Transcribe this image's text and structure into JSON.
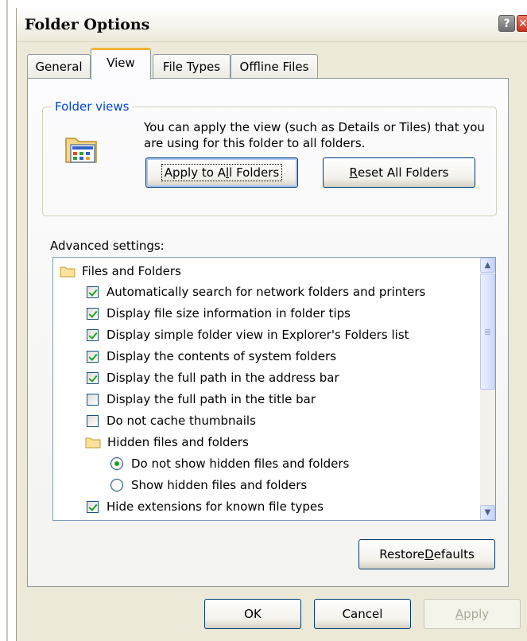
{
  "window": {
    "title": "Folder Options",
    "help_glyph": "?",
    "close_glyph": "✕"
  },
  "tabs": [
    {
      "label": "General",
      "active": false
    },
    {
      "label": "View",
      "active": true
    },
    {
      "label": "File Types",
      "active": false
    },
    {
      "label": "Offline Files",
      "active": false
    }
  ],
  "folder_views": {
    "legend": "Folder views",
    "description": "You can apply the view (such as Details or Tiles) that you are using for this folder to all folders.",
    "apply_button": {
      "pre": "Apply to A",
      "accel": "l",
      "post": "l Folders"
    },
    "reset_button": {
      "pre": "",
      "accel": "R",
      "post": "eset All Folders"
    }
  },
  "advanced": {
    "label": "Advanced settings:",
    "items": [
      {
        "kind": "folder",
        "label": "Files and Folders",
        "indent": 0
      },
      {
        "kind": "checkbox",
        "checked": true,
        "label": "Automatically search for network folders and printers",
        "indent": 1
      },
      {
        "kind": "checkbox",
        "checked": true,
        "label": "Display file size information in folder tips",
        "indent": 1
      },
      {
        "kind": "checkbox",
        "checked": true,
        "label": "Display simple folder view in Explorer's Folders list",
        "indent": 1
      },
      {
        "kind": "checkbox",
        "checked": true,
        "label": "Display the contents of system folders",
        "indent": 1
      },
      {
        "kind": "checkbox",
        "checked": true,
        "label": "Display the full path in the address bar",
        "indent": 1
      },
      {
        "kind": "checkbox",
        "checked": false,
        "label": "Display the full path in the title bar",
        "indent": 1
      },
      {
        "kind": "checkbox",
        "checked": false,
        "label": "Do not cache thumbnails",
        "indent": 1
      },
      {
        "kind": "folder",
        "label": "Hidden files and folders",
        "indent": 1
      },
      {
        "kind": "radio",
        "checked": true,
        "label": "Do not show hidden files and folders",
        "indent": 2
      },
      {
        "kind": "radio",
        "checked": false,
        "label": "Show hidden files and folders",
        "indent": 2
      },
      {
        "kind": "checkbox",
        "checked": true,
        "label": "Hide extensions for known file types",
        "indent": 1
      }
    ],
    "scroll": {
      "up_glyph": "▲",
      "down_glyph": "▼"
    }
  },
  "restore_button": {
    "pre": "Restore ",
    "accel": "D",
    "post": "efaults"
  },
  "footer": {
    "ok_label": "OK",
    "cancel_label": "Cancel",
    "apply_button": {
      "pre": "",
      "accel": "A",
      "post": "pply",
      "disabled": true
    }
  },
  "colors": {
    "dialog_bg": "#ece9d8",
    "legend_blue": "#0046d5",
    "check_green": "#21a121",
    "tab_highlight": "#f4b437"
  }
}
